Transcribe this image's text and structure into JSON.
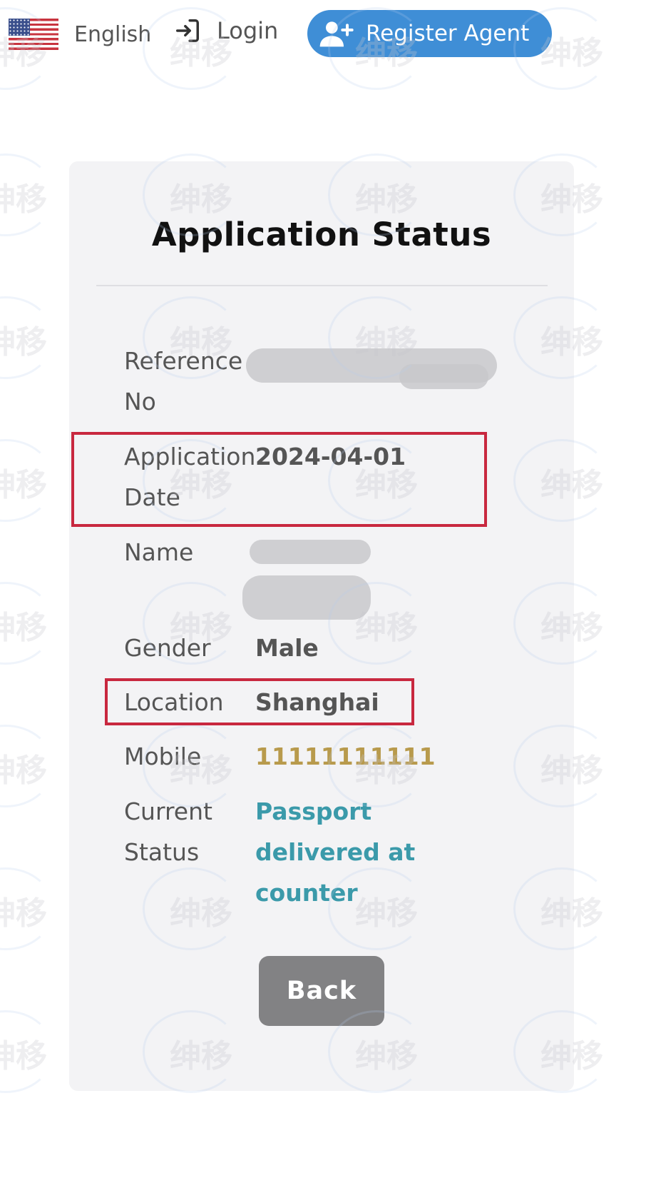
{
  "header": {
    "language_label": "English",
    "login_label": "Login",
    "register_label": "Register Agent"
  },
  "card": {
    "title": "Application Status",
    "fields": [
      {
        "label": "Reference\nNo",
        "value": ""
      },
      {
        "label": "Application\nDate",
        "value": "2024-04-01"
      },
      {
        "label": "Name",
        "value": ""
      },
      {
        "label": "Gender",
        "value": "Male"
      },
      {
        "label": "Location",
        "value": "Shanghai"
      },
      {
        "label": "Mobile",
        "value": "11111111111"
      },
      {
        "label": "Current\nStatus",
        "value": "Passport\ndelivered at\ncounter"
      }
    ],
    "back_label": "Back"
  },
  "watermark": {
    "text": "绅移"
  },
  "colors": {
    "accent": "#3f8ed6",
    "highlight": "#c8283f",
    "mobile": "#b89a4c",
    "status": "#3b9aaa",
    "button": "#828284"
  },
  "icons": {
    "language": "us-flag-icon",
    "login": "login-arrow-icon",
    "register": "user-plus-icon"
  }
}
